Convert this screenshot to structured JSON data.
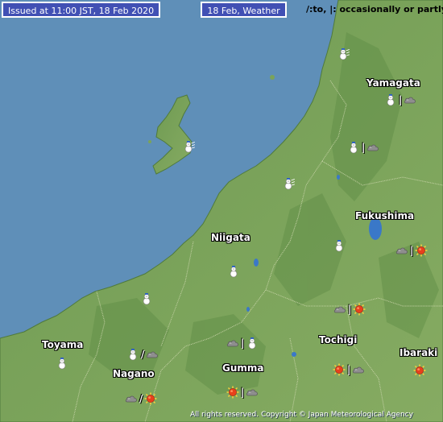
{
  "header": {
    "issued": "Issued at 11:00 JST, 18 Feb 2020",
    "product": "18 Feb, Weather",
    "legend": "/:to, |: occasionally or partly"
  },
  "prefectures": {
    "yamagata": "Yamagata",
    "fukushima": "Fukushima",
    "niigata": "Niigata",
    "toyama": "Toyama",
    "nagano": "Nagano",
    "gumma": "Gumma",
    "tochigi": "Tochigi",
    "ibaraki": "Ibaraki"
  },
  "forecasts": {
    "yamagata_west": {
      "icons": [
        "snow-windy"
      ],
      "separator": ""
    },
    "yamagata": {
      "icons": [
        "snow",
        "cloud"
      ],
      "separator": "|"
    },
    "yamagata_south": {
      "icons": [
        "snow",
        "cloud"
      ],
      "separator": "|"
    },
    "sado": {
      "icons": [
        "snow-windy"
      ],
      "separator": ""
    },
    "niigata_north": {
      "icons": [
        "snow-windy"
      ],
      "separator": ""
    },
    "fukushima_aizu": {
      "icons": [
        "snow"
      ],
      "separator": ""
    },
    "fukushima_east": {
      "icons": [
        "cloud",
        "sun"
      ],
      "separator": "|"
    },
    "niigata": {
      "icons": [
        "snow"
      ],
      "separator": ""
    },
    "joetsu": {
      "icons": [
        "snow"
      ],
      "separator": ""
    },
    "toyama": {
      "icons": [
        "snow"
      ],
      "separator": ""
    },
    "nagano_north": {
      "icons": [
        "snow",
        "cloud"
      ],
      "separator": "/"
    },
    "nagano_south": {
      "icons": [
        "cloud",
        "sun"
      ],
      "separator": "/"
    },
    "gumma_north": {
      "icons": [
        "cloud",
        "snow"
      ],
      "separator": "|"
    },
    "gumma_south": {
      "icons": [
        "sun",
        "cloud"
      ],
      "separator": "|"
    },
    "tochigi_north": {
      "icons": [
        "cloud",
        "sun"
      ],
      "separator": "|"
    },
    "tochigi_south": {
      "icons": [
        "sun",
        "cloud"
      ],
      "separator": "|"
    },
    "ibaraki": {
      "icons": [
        "sun"
      ],
      "separator": ""
    }
  },
  "copyright": "All rights reserved. Copyright © Japan Meteorological Agency",
  "colors": {
    "sea": "#5f8fb8",
    "land": "#7aa35a",
    "header_bg": "#4150b4",
    "sun": "#e8401c",
    "cloud": "#8c8c8c"
  }
}
